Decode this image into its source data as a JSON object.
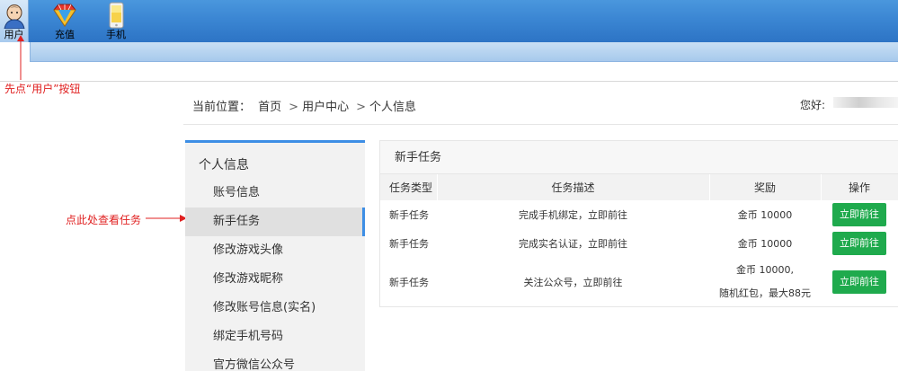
{
  "toolbar": {
    "items": [
      {
        "label": "用户",
        "icon": "user-icon"
      },
      {
        "label": "充值",
        "icon": "recharge-gem-icon"
      },
      {
        "label": "手机",
        "icon": "phone-icon"
      }
    ]
  },
  "annotations": {
    "top": "先点“用户”按钮",
    "middle": "点此处查看任务"
  },
  "breadcrumb": {
    "prefix": "当前位置：",
    "items": [
      "首页",
      "用户中心",
      "个人信息"
    ],
    "separator": ">"
  },
  "greeting": "您好:",
  "menu": {
    "title": "个人信息",
    "items": [
      "账号信息",
      "新手任务",
      "修改游戏头像",
      "修改游戏昵称",
      "修改账号信息(实名)",
      "绑定手机号码",
      "官方微信公众号"
    ],
    "active_index": 1
  },
  "panel": {
    "title": "新手任务",
    "columns": [
      "任务类型",
      "任务描述",
      "奖励",
      "操作"
    ],
    "rows": [
      {
        "type": "新手任务",
        "desc": "完成手机绑定，立即前往",
        "reward": [
          "金币 10000"
        ],
        "action": "立即前往"
      },
      {
        "type": "新手任务",
        "desc": "完成实名认证，立即前往",
        "reward": [
          "金币 10000"
        ],
        "action": "立即前往"
      },
      {
        "type": "新手任务",
        "desc": "关注公众号，立即前往",
        "reward": [
          "金币 10000,",
          "随机红包，最大88元"
        ],
        "action": "立即前往"
      }
    ]
  },
  "colors": {
    "toolbar_blue": "#3b86d3",
    "accent_blue": "#3d8ee5",
    "button_green": "#1faa4d",
    "annotation_red": "#e02020"
  }
}
